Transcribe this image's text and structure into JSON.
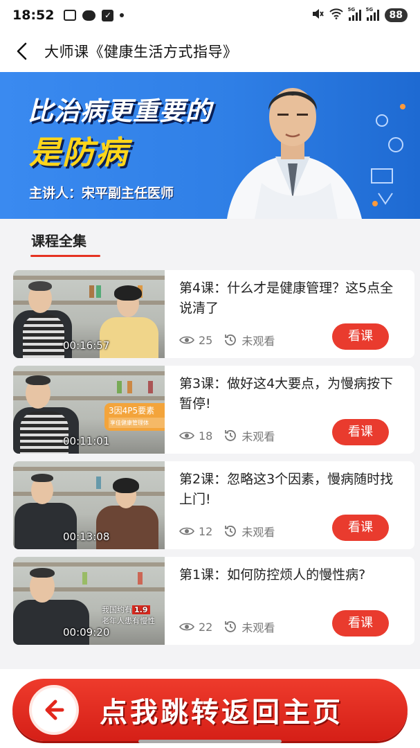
{
  "status_bar": {
    "time": "18:52",
    "signal1_label": "5G",
    "signal2_label": "5G",
    "battery": "88"
  },
  "header": {
    "title": "大师课《健康生活方式指导》"
  },
  "banner": {
    "line1": "比治病更重要的",
    "line2": "是防病",
    "speaker": "主讲人：宋平副主任医师",
    "colors": {
      "background": "#2f7fe6",
      "highlight": "#ffd51a"
    }
  },
  "tab": {
    "label": "课程全集",
    "accent": "#e53222"
  },
  "lessons": [
    {
      "title": "第4课：什么才是健康管理？这5点全说清了",
      "duration": "00:16:57",
      "views": "25",
      "status": "未观看",
      "button": "看课"
    },
    {
      "title": "第3课：做好这4大要点，为慢病按下暂停!",
      "duration": "00:11:01",
      "views": "18",
      "status": "未观看",
      "button": "看课",
      "overlay": "3因4P5要素",
      "overlay_sub": "享佳健康管理体"
    },
    {
      "title": "第2课：忽略这3个因素，慢病随时找上门!",
      "duration": "00:13:08",
      "views": "12",
      "status": "未观看",
      "button": "看课"
    },
    {
      "title": "第1课：如何防控烦人的慢性病?",
      "duration": "00:09:20",
      "views": "22",
      "status": "未观看",
      "button": "看课",
      "caption_a": "我国约有",
      "caption_b": "1.9",
      "caption_c": "老年人患有慢性"
    }
  ],
  "bottom": {
    "home_button": "点我跳转返回主页",
    "accent": "#e93b2e"
  }
}
